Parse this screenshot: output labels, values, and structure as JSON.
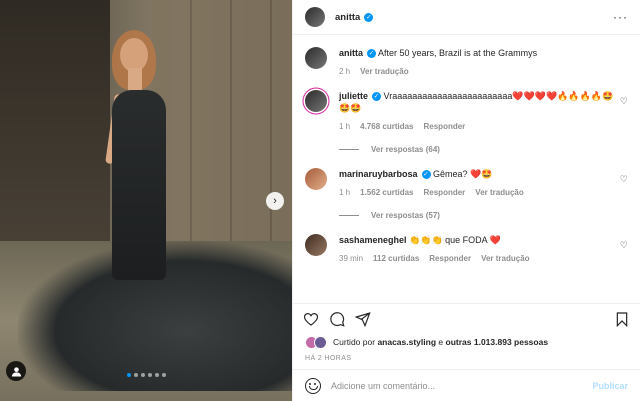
{
  "header": {
    "username": "anitta",
    "more_icon": "ellipsis-icon"
  },
  "caption": {
    "username": "anitta",
    "text": "After 50 years, Brazil is at the Grammys",
    "time": "2 h",
    "translate": "Ver tradução"
  },
  "comments": [
    {
      "username": "juliette",
      "text": "Vraaaaaaaaaaaaaaaaaaaaaaaa❤️❤️❤️❤️🔥🔥🔥🔥🤩🤩🤩",
      "time": "1 h",
      "likes": "4.768 curtidas",
      "reply": "Responder",
      "replies": "Ver respostas (64)"
    },
    {
      "username": "marinaruybarbosa",
      "text": "Gêmea? ❤️🤩",
      "time": "1 h",
      "likes": "1.562 curtidas",
      "reply": "Responder",
      "translate": "Ver tradução",
      "replies": "Ver respostas (57)"
    },
    {
      "username": "sashameneghel",
      "text": "👏👏👏 que FODA ❤️",
      "time": "39 min",
      "likes": "112 curtidas",
      "reply": "Responder",
      "translate": "Ver tradução"
    }
  ],
  "likes": {
    "prefix": "Curtido por",
    "user": "anacas.styling",
    "middle": "e",
    "rest": "outras 1.013.893 pessoas"
  },
  "timestamp": "HÁ 2 HORAS",
  "add_comment": {
    "placeholder": "Adicione um comentário...",
    "post_label": "Publicar"
  },
  "carousel": {
    "dot_count": 6,
    "active_index": 0
  },
  "colors": {
    "accent": "#0095f6",
    "muted": "#8e8e8e",
    "post_disabled": "#b2dffc"
  }
}
